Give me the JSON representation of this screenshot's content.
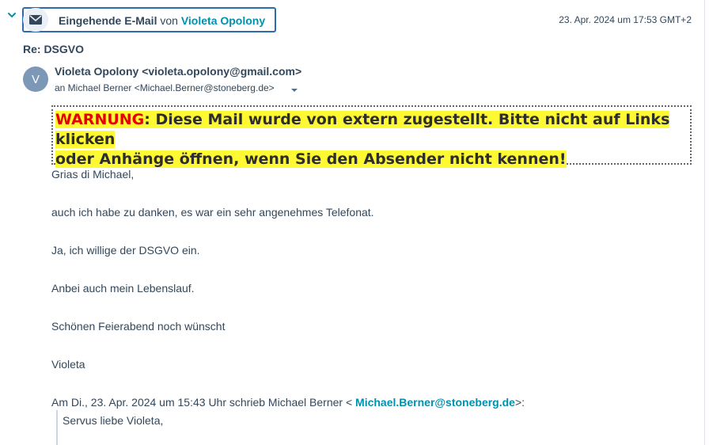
{
  "header": {
    "type_label": "Eingehende E-Mail",
    "from_word": "von",
    "sender_name": "Violeta Opolony",
    "timestamp": "23. Apr. 2024 um 17:53 GMT+2"
  },
  "subject": "Re: DSGVO",
  "sender": {
    "avatar_letter": "V",
    "name_email": "Violeta Opolony <violeta.opolony@gmail.com>",
    "recipient": "an Michael Berner <Michael.Berner@stoneberg.de>"
  },
  "warning": {
    "label": "WARNUNG",
    "text": ": Diese Mail wurde von extern zugestellt. Bitte nicht auf Links klicken",
    "text2": "oder Anhänge öffnen, wenn Sie den Absender nicht kennen!"
  },
  "body": {
    "lines": [
      "Grias di Michael,",
      "auch ich habe zu danken, es war ein sehr angenehmes Telefonat.",
      "Ja, ich willige der DSGVO ein.",
      "Anbei auch mein Lebenslauf.",
      "Schönen Feierabend noch wünscht",
      "Violeta"
    ]
  },
  "quote": {
    "intro": "Am Di., 23. Apr. 2024 um 15:43 Uhr schrieb Michael Berner < ",
    "link": "Michael.Berner@stoneberg.de",
    "suffix": ">:",
    "first_line": "Servus liebe Violeta,"
  },
  "colors": {
    "accent": "#0091ae",
    "text": "#33475b",
    "warning_highlight": "#fff933",
    "warning_label": "#e60000"
  },
  "icons": [
    "chevron-down-icon",
    "envelope-icon",
    "caret-down-icon"
  ]
}
